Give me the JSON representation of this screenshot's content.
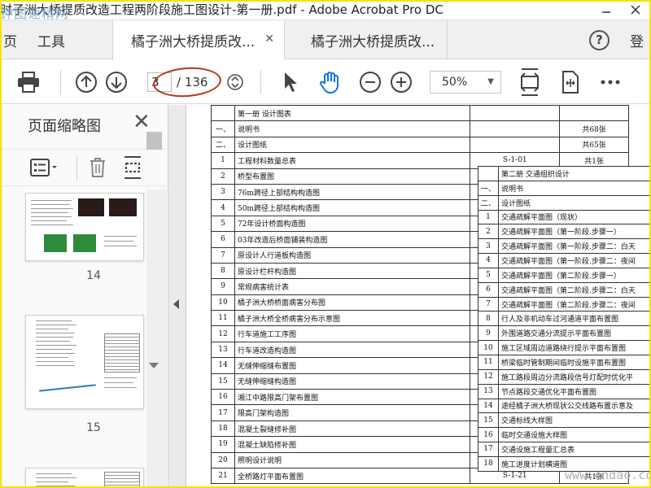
{
  "window": {
    "title": "时子洲大桥提质改造工程两阶段施工图设计-第一册.pdf - Adobe Acrobat Pro DC",
    "watermark": "钟图速精网"
  },
  "tabs": {
    "page_label": "页",
    "tools_label": "工具",
    "doc1_label": "橘子洲大桥提质改...",
    "doc2_label": "橘子洲大桥提质改...",
    "help_label": "?",
    "login_label": "登"
  },
  "toolbar": {
    "current_page": "3",
    "total_pages": "/ 136",
    "zoom": "50%"
  },
  "sidebar": {
    "title": "页面缩略图",
    "thumbnails": [
      {
        "label": "14"
      },
      {
        "label": "15"
      }
    ]
  },
  "document": {
    "table1_rows": [
      {
        "num": "",
        "name": "第一册  设计图表",
        "code": "",
        "count": ""
      },
      {
        "num": "一、",
        "name": "说明书",
        "code": "",
        "count": "共68张"
      },
      {
        "num": "二、",
        "name": "设计图纸",
        "code": "",
        "count": "共65张"
      },
      {
        "num": "1",
        "name": "工程材料数量总表",
        "code": "S-1-01",
        "count": "共1张"
      },
      {
        "num": "2",
        "name": "桥型布置图",
        "code": "",
        "count": ""
      },
      {
        "num": "3",
        "name": "76m跨径上部结构构造图",
        "code": "",
        "count": ""
      },
      {
        "num": "4",
        "name": "50m跨径上部结构构造图",
        "code": "",
        "count": ""
      },
      {
        "num": "5",
        "name": "72年设计桥面构造图",
        "code": "",
        "count": ""
      },
      {
        "num": "6",
        "name": "03年改造后桥面铺装构造图",
        "code": "",
        "count": ""
      },
      {
        "num": "7",
        "name": "原设计人行道板构造图",
        "code": "",
        "count": ""
      },
      {
        "num": "8",
        "name": "原设计栏杆构造图",
        "code": "",
        "count": ""
      },
      {
        "num": "9",
        "name": "常规病害统计表",
        "code": "",
        "count": ""
      },
      {
        "num": "10",
        "name": "橘子洲大桥桥面病害分布图",
        "code": "",
        "count": ""
      },
      {
        "num": "11",
        "name": "橘子洲大桥全桥病害分布示意图",
        "code": "",
        "count": ""
      },
      {
        "num": "12",
        "name": "行车道施工工序图",
        "code": "",
        "count": ""
      },
      {
        "num": "13",
        "name": "行车道改造构造图",
        "code": "",
        "count": ""
      },
      {
        "num": "14",
        "name": "无缝伸缩缝布置图",
        "code": "",
        "count": ""
      },
      {
        "num": "15",
        "name": "无缝伸缩缝构造图",
        "code": "",
        "count": ""
      },
      {
        "num": "16",
        "name": "湘江中路限高门架布置图",
        "code": "",
        "count": ""
      },
      {
        "num": "17",
        "name": "限高门架构造图",
        "code": "",
        "count": ""
      },
      {
        "num": "18",
        "name": "混凝土裂缝修补图",
        "code": "",
        "count": ""
      },
      {
        "num": "19",
        "name": "混凝土缺陷修补图",
        "code": "",
        "count": ""
      },
      {
        "num": "20",
        "name": "照明设计说明",
        "code": "",
        "count": ""
      },
      {
        "num": "21",
        "name": "全桥路灯平面布置图",
        "code": "S-1-21",
        "count": "共1张"
      }
    ],
    "table2_rows": [
      {
        "num": "",
        "name": "第二册  交通组织设计"
      },
      {
        "num": "一、",
        "name": "说明书"
      },
      {
        "num": "二、",
        "name": "设计图纸"
      },
      {
        "num": "1",
        "name": "交通疏解平面图（现状）"
      },
      {
        "num": "2",
        "name": "交通疏解平面图（第一阶段.步骤一）"
      },
      {
        "num": "3",
        "name": "交通疏解平面图（第一阶段.步骤二：白天"
      },
      {
        "num": "4",
        "name": "交通疏解平面图（第一阶段.步骤二：夜间"
      },
      {
        "num": "5",
        "name": "交通疏解平面图（第二阶段.步骤一）"
      },
      {
        "num": "6",
        "name": "交通疏解平面图（第二阶段.步骤二：白天"
      },
      {
        "num": "7",
        "name": "交通疏解平面图（第二阶段.步骤二：夜间"
      },
      {
        "num": "8",
        "name": "行人及非机动车过河通道平面布置图"
      },
      {
        "num": "9",
        "name": "外围道路交通分流提示平面布置图"
      },
      {
        "num": "10",
        "name": "施工区域周边道路绕行提示平面布置图"
      },
      {
        "num": "11",
        "name": "桥梁临时管制期间临时设施平面布置图"
      },
      {
        "num": "12",
        "name": "施工路段周边分流路段信号灯配时优化平"
      },
      {
        "num": "13",
        "name": "节点路段交通优化平面布置图"
      },
      {
        "num": "14",
        "name": "途经橘子洲大桥现状公交线路布置示意及"
      },
      {
        "num": "15",
        "name": "交通标线大样图"
      },
      {
        "num": "16",
        "name": "临时交通设施大样图"
      },
      {
        "num": "17",
        "name": "交通设施工程量汇总表"
      },
      {
        "num": "18",
        "name": "施工进度计划横道图"
      }
    ],
    "site_watermark": "www.cndao.com"
  },
  "icons": {
    "print": "print-icon",
    "page_up": "arrow-up-circle-icon",
    "page_down": "arrow-down-circle-icon",
    "select": "cursor-arrow-icon",
    "hand": "hand-icon",
    "zoom_out": "zoom-out-icon",
    "zoom_in": "zoom-in-icon",
    "fit_page": "fit-page-icon",
    "rotate": "rotate-view-icon",
    "more": "more-icon"
  },
  "colors": {
    "frame": "#f4e400",
    "annotation": "#b8341f",
    "hand_tool": "#1473e6"
  }
}
